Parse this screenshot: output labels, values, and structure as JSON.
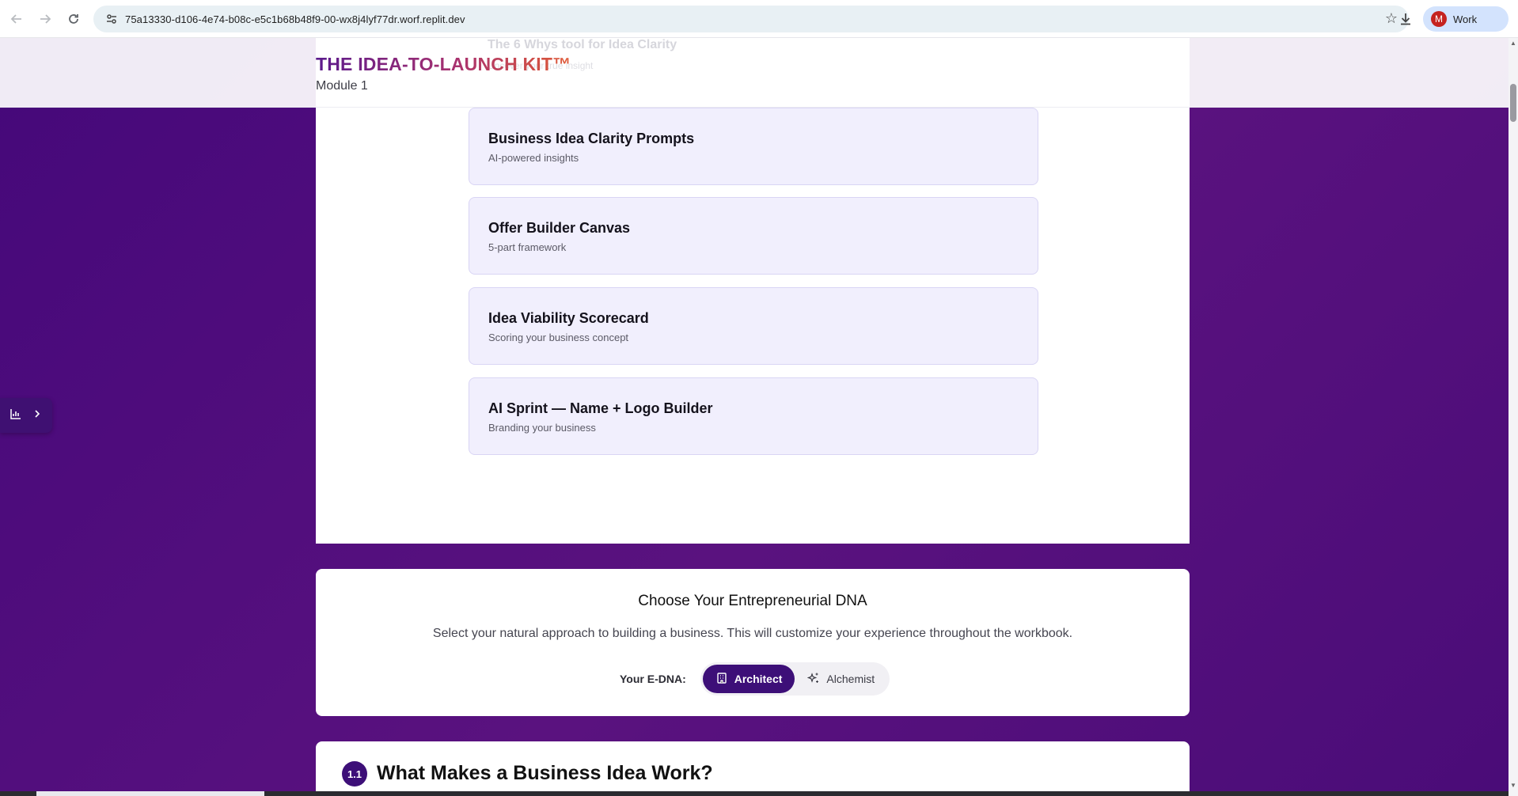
{
  "browser": {
    "url": "75a13330-d106-4e74-b08c-e5c1b68b48f9-00-wx8j4lyf77dr.worf.replit.dev",
    "profile_initial": "M",
    "profile_label": "Work"
  },
  "header": {
    "title": "THE IDEA-TO-LAUNCH KIT™",
    "subtitle": "Module 1",
    "ghost_title": "The 6 Whys tool for Idea Clarity",
    "ghost_sub": "Uncover your true insight"
  },
  "resources": [
    {
      "title": "Business Idea Clarity Prompts",
      "subtitle": "AI-powered insights"
    },
    {
      "title": "Offer Builder Canvas",
      "subtitle": "5-part framework"
    },
    {
      "title": "Idea Viability Scorecard",
      "subtitle": "Scoring your business concept"
    },
    {
      "title": "AI Sprint — Name + Logo Builder",
      "subtitle": "Branding your business"
    }
  ],
  "dna": {
    "title": "Choose Your Entrepreneurial DNA",
    "description": "Select your natural approach to building a business. This will customize your experience throughout the workbook.",
    "label": "Your E-DNA:",
    "options": [
      {
        "label": "Architect",
        "icon": "building-icon",
        "active": true
      },
      {
        "label": "Alchemist",
        "icon": "sparkles-icon",
        "active": false
      }
    ]
  },
  "section": {
    "number": "1.1",
    "title": "What Makes a Business Idea Work?"
  },
  "colors": {
    "brand_purple": "#3d0f78",
    "background_purple": "#4f0d7c",
    "card_lavender": "#f1effd"
  }
}
